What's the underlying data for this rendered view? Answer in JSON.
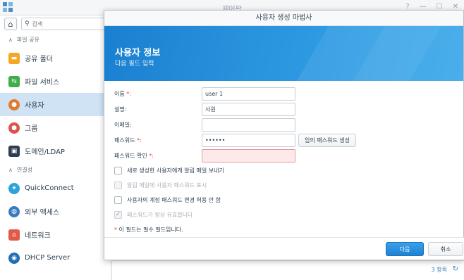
{
  "control_panel": {
    "title": "제어판",
    "search_placeholder": "검색",
    "sections": [
      {
        "header": "파일 공유",
        "items": [
          {
            "label": "공유 폴더",
            "icon": "shared-folder-icon",
            "color": "#f5a623"
          },
          {
            "label": "파일 서비스",
            "icon": "file-services-icon",
            "color": "#3fae49"
          },
          {
            "label": "사용자",
            "icon": "user-icon",
            "color": "#e07b2e",
            "active": true
          },
          {
            "label": "그룹",
            "icon": "group-icon",
            "color": "#d9534f"
          },
          {
            "label": "도메인/LDAP",
            "icon": "domain-ldap-icon",
            "color": "#2c3e50"
          }
        ]
      },
      {
        "header": "연결성",
        "items": [
          {
            "label": "QuickConnect",
            "icon": "quickconnect-icon",
            "color": "#2aa4d9"
          },
          {
            "label": "외부 액세스",
            "icon": "external-access-icon",
            "color": "#3a7bbf"
          },
          {
            "label": "네트워크",
            "icon": "network-icon",
            "color": "#e05a4a"
          },
          {
            "label": "DHCP Server",
            "icon": "dhcp-server-icon",
            "color": "#1f6fb5"
          }
        ]
      }
    ],
    "item_count": "3 항목"
  },
  "wizard": {
    "title": "사용자 생성 마법사",
    "heading": "사용자 정보",
    "subheading": "다음 필드 입력",
    "fields": {
      "name": {
        "label": "이름",
        "required_mark": "*:",
        "value": "user 1"
      },
      "description": {
        "label": "설명:",
        "value": "사원"
      },
      "email": {
        "label": "이메일:",
        "value": ""
      },
      "password": {
        "label": "패스워드",
        "required_mark": "*:",
        "value": "••••••"
      },
      "confirm_password": {
        "label": "패스워드 확인",
        "required_mark": "*:",
        "value": ""
      }
    },
    "generate_password_button": "임의 패스워드 생성",
    "options": [
      {
        "label": "새로 생성한 사용자에게 알림 메일 보내기",
        "checked": false,
        "disabled": false
      },
      {
        "label": "알림 메일에 사용자 패스워드 표시",
        "checked": false,
        "disabled": true
      },
      {
        "label": "사용자의 계정 패스워드 변경 허용 안 함",
        "checked": false,
        "disabled": false
      },
      {
        "label": "패스워드가 항상 유효합니다",
        "checked": true,
        "disabled": true
      }
    ],
    "required_note_mark": "*",
    "required_note": "이 필드는 필수 필드입니다.",
    "next_button": "다음",
    "cancel_button": "취소",
    "accent_color": "#1f82d2",
    "error_color": "#fde9e9"
  }
}
